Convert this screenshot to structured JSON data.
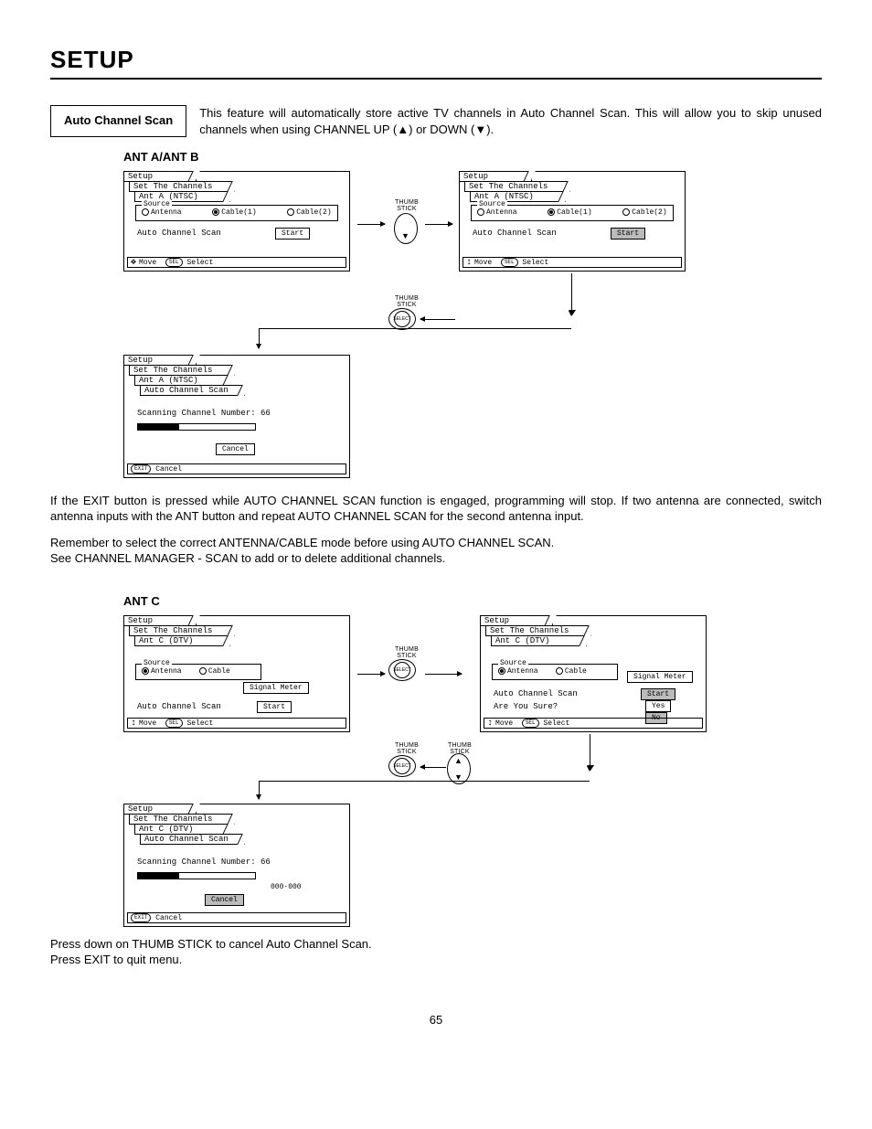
{
  "page": {
    "title": "SETUP",
    "number": "65"
  },
  "feature": {
    "label": "Auto Channel Scan",
    "desc_a": "This feature will automatically store active TV channels in Auto Channel Scan.  This will allow you to skip unused channels when using CHANNEL UP (",
    "desc_b": ") or DOWN (",
    "desc_c": ")."
  },
  "section_a": {
    "label": "ANT A/ANT B"
  },
  "section_c": {
    "label": "ANT C"
  },
  "menus": {
    "setup": "Setup",
    "set_channels": "Set The Channels",
    "ant_a": "Ant A (NTSC)",
    "ant_c": "Ant C (DTV)",
    "auto_scan_tab": "Auto Channel Scan",
    "source": "Source",
    "antenna": "Antenna",
    "cable": "Cable",
    "cable1": "Cable(1)",
    "cable2": "Cable(2)",
    "auto_scan_line": "Auto Channel Scan",
    "start": "Start",
    "status_move": "Move",
    "status_select": "Select",
    "status_cancel": "Cancel",
    "scanning": "Scanning Channel Number: 66",
    "chan_id": "000-000",
    "cancel": "Cancel",
    "signal_meter": "Signal Meter",
    "sure": "Are You Sure?",
    "yes": "Yes",
    "no": "No",
    "exit_cap": "EXIT",
    "sel_cap": "SEL"
  },
  "ctrl": {
    "thumb": "THUMB",
    "stick": "STICK",
    "select": "SELECT"
  },
  "body": {
    "p1": "If the EXIT button is pressed while AUTO CHANNEL SCAN function is engaged, programming will stop.  If two antenna are connected, switch antenna inputs with the ANT button and repeat AUTO CHANNEL SCAN for the second antenna input.",
    "p2": "Remember to select the correct ANTENNA/CABLE mode before using AUTO CHANNEL SCAN.",
    "p3": "See CHANNEL MANAGER - SCAN to add or to delete additional channels.",
    "p4": "Press down on THUMB STICK to cancel Auto Channel Scan.",
    "p5": "Press EXIT to quit menu."
  }
}
